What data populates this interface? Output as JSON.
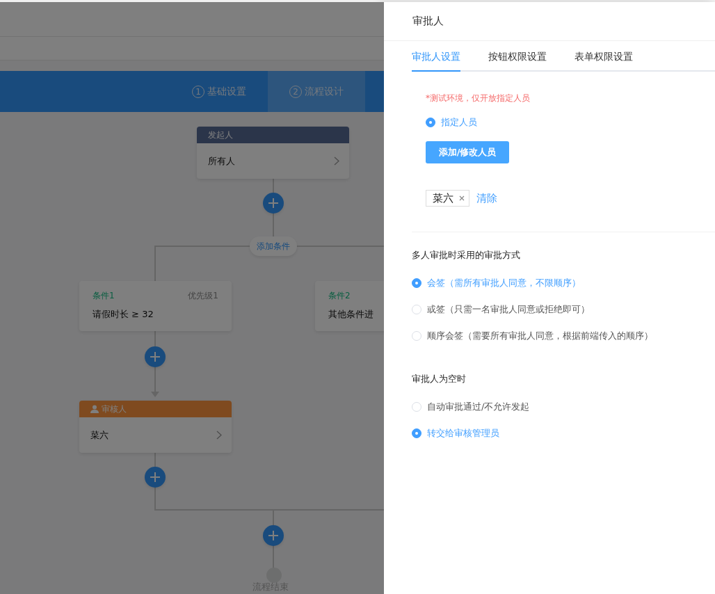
{
  "header_steps": [
    {
      "number": "1",
      "label": "基础设置",
      "selected": false
    },
    {
      "number": "2",
      "label": "流程设计",
      "selected": true
    }
  ],
  "flow": {
    "initiator": {
      "title": "发起人",
      "value": "所有人"
    },
    "add_condition": "添加条件",
    "conditions": [
      {
        "name": "条件1",
        "priority": "优先级1",
        "rule": "请假时长 ≥ 32"
      },
      {
        "name": "条件2",
        "rule": "其他条件进"
      }
    ],
    "approver": {
      "title": "审核人",
      "value": "菜六"
    },
    "end": "流程结束"
  },
  "drawer": {
    "title": "审批人",
    "tabs": [
      {
        "label": "审批人设置",
        "selected": true
      },
      {
        "label": "按钮权限设置",
        "selected": false
      },
      {
        "label": "表单权限设置",
        "selected": false
      }
    ],
    "notice": "*测试环境，仅开放指定人员",
    "assign_options": [
      {
        "label": "指定人员",
        "selected": true
      }
    ],
    "add_button": "添加/修改人员",
    "selected_people": [
      {
        "name": "菜六"
      }
    ],
    "clear_link": "清除",
    "sections": [
      {
        "title": "多人审批时采用的审批方式",
        "options": [
          {
            "label": "会签（需所有审批人同意，不限顺序）",
            "selected": true
          },
          {
            "label": "或签（只需一名审批人同意或拒绝即可）",
            "selected": false
          },
          {
            "label": "顺序会签（需要所有审批人同意，根据前端传入的顺序）",
            "selected": false
          }
        ]
      },
      {
        "title": "审批人为空时",
        "options": [
          {
            "label": "自动审批通过/不允许发起",
            "selected": false
          },
          {
            "label": "转交给审核管理员",
            "selected": true
          }
        ]
      }
    ]
  }
}
